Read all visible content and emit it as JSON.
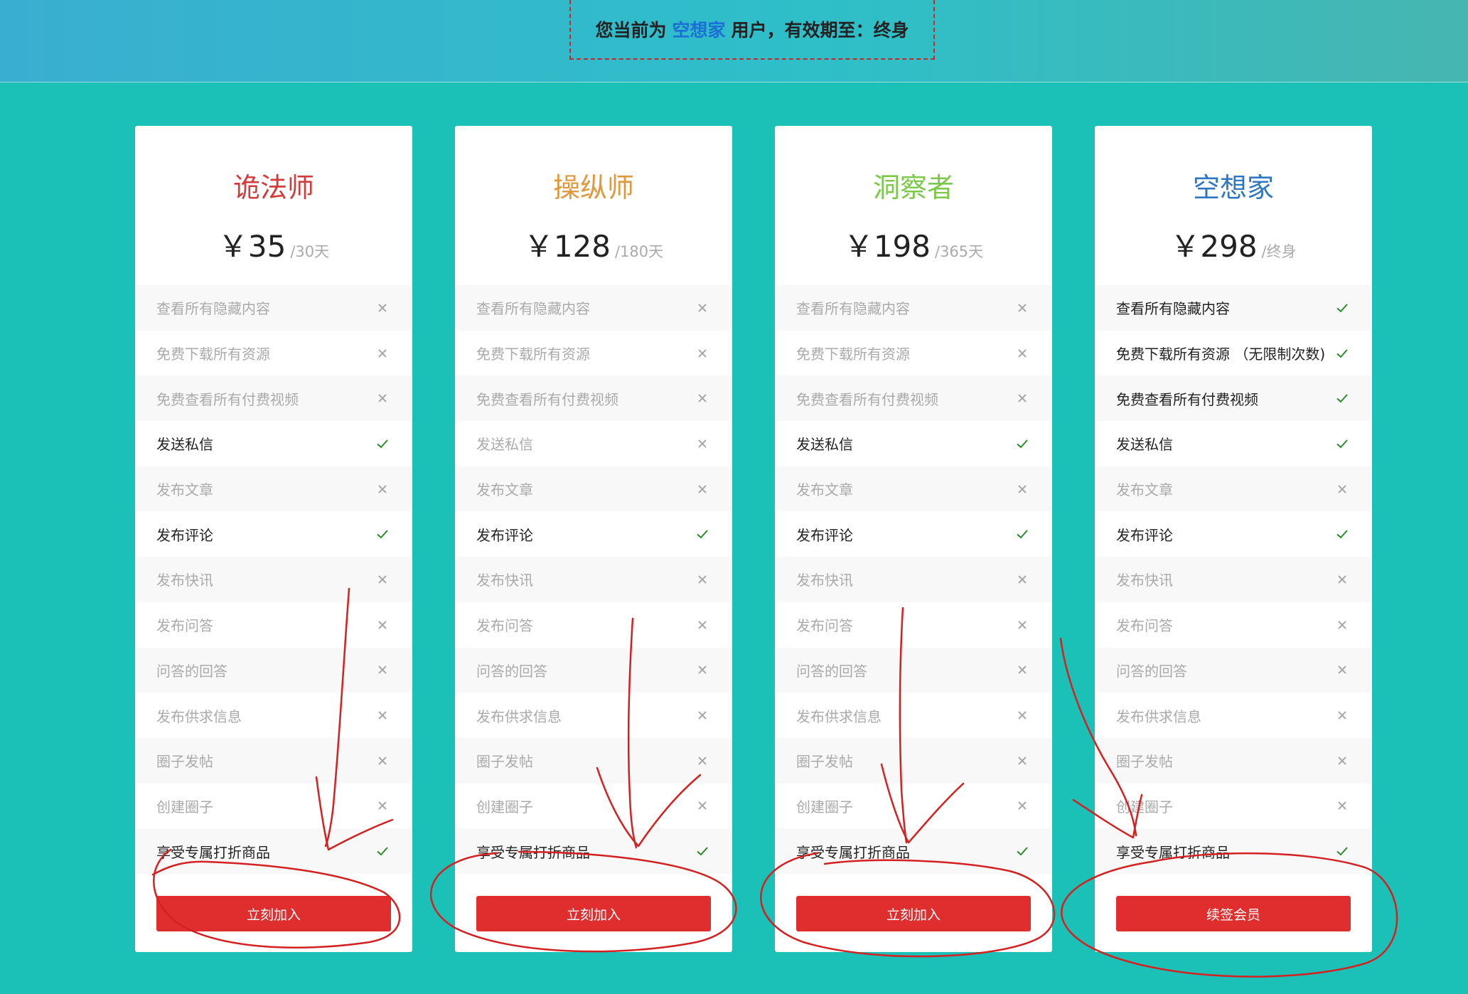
{
  "status": {
    "prefix": "您当前为",
    "level": "空想家",
    "suffix": "用户，有效期至：终身"
  },
  "colors": {
    "title_1": "#d33b3b",
    "title_2": "#e0983a",
    "title_3": "#7cc84a",
    "title_4": "#2f77c3",
    "button": "#e02e2e",
    "check": "#2a8a2a",
    "cross": "#a8a8a8"
  },
  "plans": [
    {
      "title": "诡法师",
      "price": "￥35",
      "period": "/30天",
      "button": "立刻加入",
      "features": [
        {
          "label": "查看所有隐藏内容",
          "ok": false
        },
        {
          "label": "免费下载所有资源",
          "ok": false
        },
        {
          "label": "免费查看所有付费视频",
          "ok": false
        },
        {
          "label": "发送私信",
          "ok": true
        },
        {
          "label": "发布文章",
          "ok": false
        },
        {
          "label": "发布评论",
          "ok": true
        },
        {
          "label": "发布快讯",
          "ok": false
        },
        {
          "label": "发布问答",
          "ok": false
        },
        {
          "label": "问答的回答",
          "ok": false
        },
        {
          "label": "发布供求信息",
          "ok": false
        },
        {
          "label": "圈子发帖",
          "ok": false
        },
        {
          "label": "创建圈子",
          "ok": false
        },
        {
          "label": "享受专属打折商品",
          "ok": true
        }
      ]
    },
    {
      "title": "操纵师",
      "price": "￥128",
      "period": "/180天",
      "button": "立刻加入",
      "features": [
        {
          "label": "查看所有隐藏内容",
          "ok": false
        },
        {
          "label": "免费下载所有资源",
          "ok": false
        },
        {
          "label": "免费查看所有付费视频",
          "ok": false
        },
        {
          "label": "发送私信",
          "ok": false
        },
        {
          "label": "发布文章",
          "ok": false
        },
        {
          "label": "发布评论",
          "ok": true
        },
        {
          "label": "发布快讯",
          "ok": false
        },
        {
          "label": "发布问答",
          "ok": false
        },
        {
          "label": "问答的回答",
          "ok": false
        },
        {
          "label": "发布供求信息",
          "ok": false
        },
        {
          "label": "圈子发帖",
          "ok": false
        },
        {
          "label": "创建圈子",
          "ok": false
        },
        {
          "label": "享受专属打折商品",
          "ok": true
        }
      ]
    },
    {
      "title": "洞察者",
      "price": "￥198",
      "period": "/365天",
      "button": "立刻加入",
      "features": [
        {
          "label": "查看所有隐藏内容",
          "ok": false
        },
        {
          "label": "免费下载所有资源",
          "ok": false
        },
        {
          "label": "免费查看所有付费视频",
          "ok": false
        },
        {
          "label": "发送私信",
          "ok": true
        },
        {
          "label": "发布文章",
          "ok": false
        },
        {
          "label": "发布评论",
          "ok": true
        },
        {
          "label": "发布快讯",
          "ok": false
        },
        {
          "label": "发布问答",
          "ok": false
        },
        {
          "label": "问答的回答",
          "ok": false
        },
        {
          "label": "发布供求信息",
          "ok": false
        },
        {
          "label": "圈子发帖",
          "ok": false
        },
        {
          "label": "创建圈子",
          "ok": false
        },
        {
          "label": "享受专属打折商品",
          "ok": true
        }
      ]
    },
    {
      "title": "空想家",
      "price": "￥298",
      "period": "/终身",
      "button": "续签会员",
      "features": [
        {
          "label": "查看所有隐藏内容",
          "ok": true
        },
        {
          "label": "免费下载所有资源 （无限制次数)",
          "ok": true
        },
        {
          "label": "免费查看所有付费视频",
          "ok": true
        },
        {
          "label": "发送私信",
          "ok": true
        },
        {
          "label": "发布文章",
          "ok": false
        },
        {
          "label": "发布评论",
          "ok": true
        },
        {
          "label": "发布快讯",
          "ok": false
        },
        {
          "label": "发布问答",
          "ok": false
        },
        {
          "label": "问答的回答",
          "ok": false
        },
        {
          "label": "发布供求信息",
          "ok": false
        },
        {
          "label": "圈子发帖",
          "ok": false
        },
        {
          "label": "创建圈子",
          "ok": false
        },
        {
          "label": "享受专属打折商品",
          "ok": true
        }
      ]
    }
  ]
}
